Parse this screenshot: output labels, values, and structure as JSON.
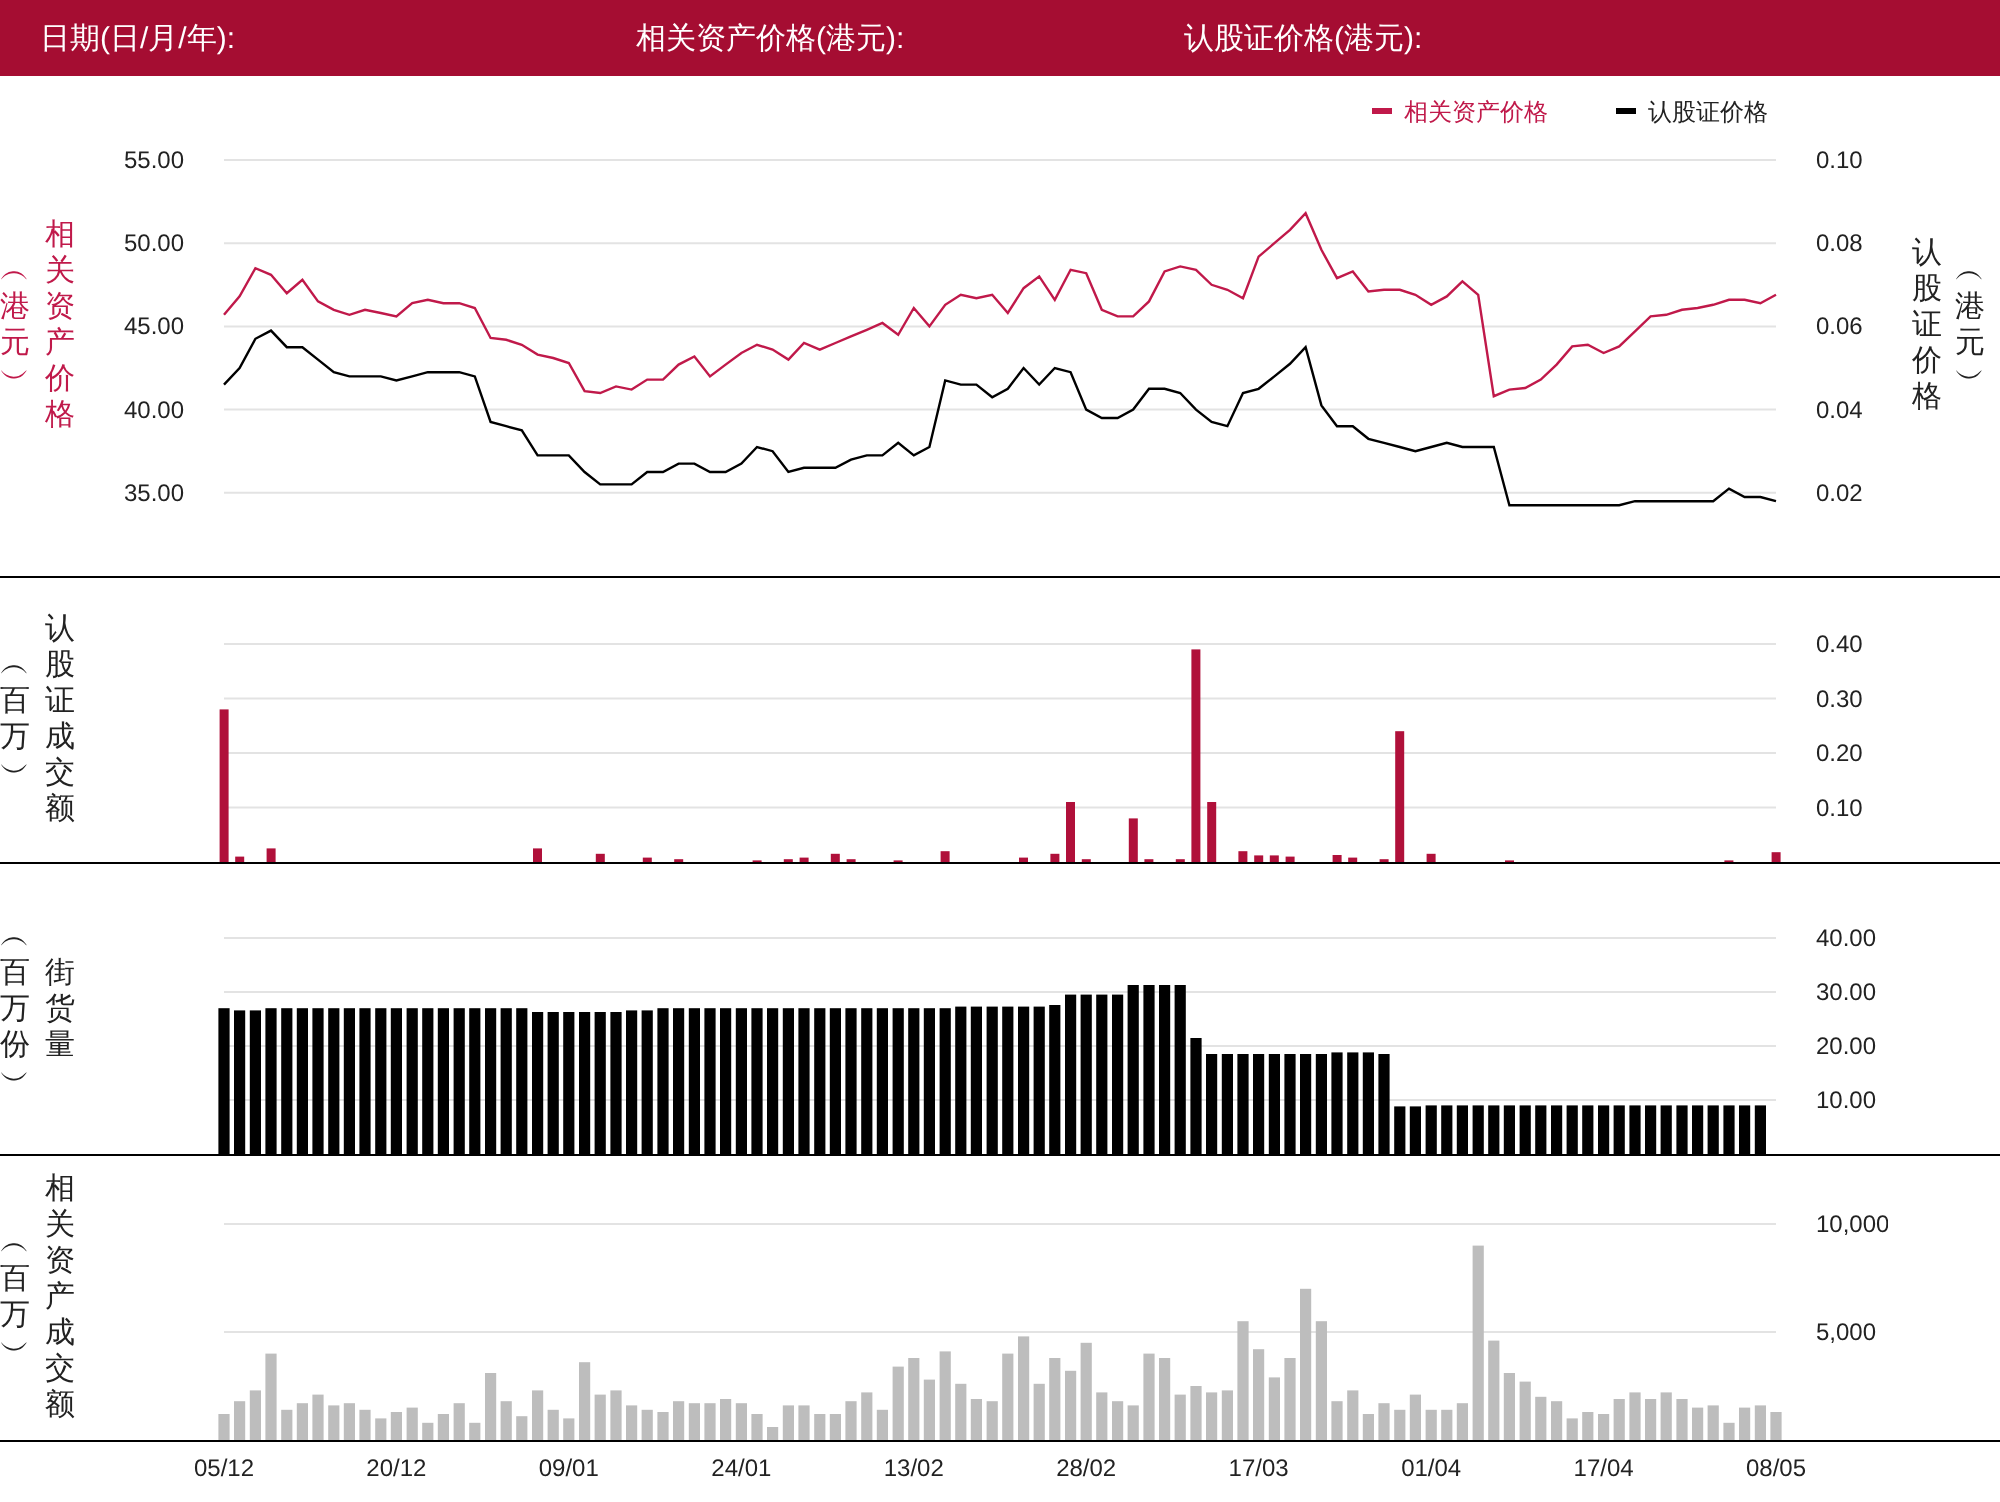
{
  "header": {
    "labels": [
      "日期(日/月/年):",
      "相关资产价格(港元):",
      "认股证价格(港元):"
    ]
  },
  "panels": [
    {
      "left_label": "相关资产价格",
      "left_unit": "︵港元︶",
      "right_label": "认股证价格",
      "right_unit": "︵港元︶",
      "chart_data": {
        "type": "line",
        "grid": true,
        "legend": "top-right",
        "ylim": [
          30,
          55
        ],
        "y2lim": [
          0,
          0.1
        ],
        "yticks": [
          {
            "value": 35,
            "label": "35.00"
          },
          {
            "value": 40,
            "label": "40.00"
          },
          {
            "value": 45,
            "label": "45.00"
          },
          {
            "value": 50,
            "label": "50.00"
          },
          {
            "value": 55,
            "label": "55.00"
          }
        ],
        "y2ticks": [
          {
            "value": 0.02,
            "label": "0.02"
          },
          {
            "value": 0.04,
            "label": "0.04"
          },
          {
            "value": 0.06,
            "label": "0.06"
          },
          {
            "value": 0.08,
            "label": "0.08"
          },
          {
            "value": 0.1,
            "label": "0.10"
          }
        ],
        "series": [
          {
            "name": "相关资产价格",
            "color": "#c0194a",
            "values": [
              45.7,
              46.8,
              48.5,
              48.1,
              47.0,
              47.8,
              46.5,
              46.0,
              45.7,
              46.0,
              45.8,
              45.6,
              46.4,
              46.6,
              46.4,
              46.4,
              46.1,
              44.3,
              44.2,
              43.9,
              43.3,
              43.1,
              42.8,
              41.1,
              41.0,
              41.4,
              41.2,
              41.8,
              41.8,
              42.7,
              43.2,
              42.0,
              42.7,
              43.4,
              43.9,
              43.6,
              43.0,
              44.0,
              43.6,
              44.0,
              44.4,
              44.8,
              45.2,
              44.5,
              46.1,
              45.0,
              46.3,
              46.9,
              46.7,
              46.9,
              45.8,
              47.3,
              48.0,
              46.6,
              48.4,
              48.2,
              46.0,
              45.6,
              45.6,
              46.5,
              48.3,
              48.6,
              48.4,
              47.5,
              47.2,
              46.7,
              49.2,
              50.0,
              50.8,
              51.8,
              49.6,
              47.9,
              48.3,
              47.1,
              47.2,
              47.2,
              46.9,
              46.3,
              46.8,
              47.7,
              46.9,
              40.8,
              41.2,
              41.3,
              41.8,
              42.7,
              43.8,
              43.9,
              43.4,
              43.8,
              44.7,
              45.6,
              45.7,
              46.0,
              46.1,
              46.3,
              46.6,
              46.6,
              46.4,
              46.9
            ]
          },
          {
            "name": "认股证价格",
            "color": "#000000",
            "axis": "y2",
            "values": [
              0.046,
              0.05,
              0.057,
              0.059,
              0.055,
              0.055,
              0.052,
              0.049,
              0.048,
              0.048,
              0.048,
              0.047,
              0.048,
              0.049,
              0.049,
              0.049,
              0.048,
              0.037,
              0.036,
              0.035,
              0.029,
              0.029,
              0.029,
              0.025,
              0.022,
              0.022,
              0.022,
              0.025,
              0.025,
              0.027,
              0.027,
              0.025,
              0.025,
              0.027,
              0.031,
              0.03,
              0.025,
              0.026,
              0.026,
              0.026,
              0.028,
              0.029,
              0.029,
              0.032,
              0.029,
              0.031,
              0.047,
              0.046,
              0.046,
              0.043,
              0.045,
              0.05,
              0.046,
              0.05,
              0.049,
              0.04,
              0.038,
              0.038,
              0.04,
              0.045,
              0.045,
              0.044,
              0.04,
              0.037,
              0.036,
              0.044,
              0.045,
              0.048,
              0.051,
              0.055,
              0.041,
              0.036,
              0.036,
              0.033,
              0.032,
              0.031,
              0.03,
              0.031,
              0.032,
              0.031,
              0.031,
              0.031,
              0.017,
              0.017,
              0.017,
              0.017,
              0.017,
              0.017,
              0.017,
              0.017,
              0.018,
              0.018,
              0.018,
              0.018,
              0.018,
              0.018,
              0.021,
              0.019,
              0.019,
              0.018
            ]
          }
        ]
      }
    },
    {
      "left_unit": "︵百万︶",
      "chart_data": {
        "type": "bar",
        "grid": true,
        "ylim": [
          0,
          0.4
        ],
        "yticks": [
          {
            "value": 0.1,
            "label": "0.10"
          },
          {
            "value": 0.2,
            "label": "0.20"
          },
          {
            "value": 0.3,
            "label": "0.30"
          },
          {
            "value": 0.4,
            "label": "0.40"
          }
        ],
        "series": [
          {
            "name": "认股证成交额",
            "color": "#b0103a",
            "values": [
              0.28,
              0.01,
              0,
              0.025,
              0,
              0,
              0,
              0,
              0,
              0,
              0,
              0,
              0,
              0,
              0,
              0,
              0,
              0,
              0,
              0,
              0.025,
              0,
              0,
              0,
              0.015,
              0,
              0,
              0.008,
              0,
              0.005,
              0,
              0,
              0,
              0,
              0.003,
              0,
              0.005,
              0.008,
              0,
              0.015,
              0.005,
              0,
              0,
              0.003,
              0,
              0,
              0.02,
              0,
              0,
              0,
              0,
              0.008,
              0,
              0.015,
              0.11,
              0.005,
              0,
              0,
              0.08,
              0.005,
              0,
              0.005,
              0.39,
              0.11,
              0,
              0.02,
              0.012,
              0.012,
              0.01,
              0,
              0,
              0.013,
              0.008,
              0,
              0.005,
              0.24,
              0,
              0.015,
              0,
              0,
              0,
              0,
              0.003,
              0,
              0,
              0,
              0,
              0,
              0,
              0,
              0,
              0,
              0,
              0,
              0,
              0,
              0.003,
              0,
              0,
              0.018
            ]
          }
        ]
      }
    },
    {
      "left_unit": "︵百万份︶",
      "chart_data": {
        "type": "bar",
        "grid": true,
        "ylim": [
          0,
          40
        ],
        "yticks": [
          {
            "value": 10,
            "label": "10.00"
          },
          {
            "value": 20,
            "label": "20.00"
          },
          {
            "value": 30,
            "label": "30.00"
          },
          {
            "value": 40,
            "label": "40.00"
          }
        ],
        "series": [
          {
            "name": "街货量",
            "color": "#000000",
            "values": [
              27,
              26.6,
              26.6,
              27,
              27,
              27,
              27,
              27,
              27,
              27,
              27,
              27,
              27,
              27,
              27,
              27,
              27,
              27,
              27,
              27,
              26.3,
              26.3,
              26.3,
              26.3,
              26.3,
              26.3,
              26.6,
              26.6,
              27,
              27,
              27,
              27,
              27,
              27,
              27,
              27,
              27,
              27,
              27,
              27,
              27,
              27,
              27,
              27,
              27,
              27,
              27,
              27.3,
              27.3,
              27.3,
              27.3,
              27.3,
              27.3,
              27.6,
              29.5,
              29.5,
              29.5,
              29.5,
              31.3,
              31.3,
              31.3,
              31.3,
              21.5,
              18.5,
              18.5,
              18.5,
              18.5,
              18.5,
              18.5,
              18.5,
              18.5,
              18.8,
              18.8,
              18.8,
              18.5,
              8.8,
              8.8,
              9,
              9,
              9,
              9,
              9,
              9,
              9,
              9,
              9,
              9,
              9,
              9,
              9,
              9,
              9,
              9,
              9,
              9,
              9,
              9,
              9,
              9,
              null
            ]
          }
        ]
      }
    },
    {
      "left_unit": "︵百万︶",
      "chart_data": {
        "type": "bar",
        "grid": true,
        "ylim": [
          0,
          10000
        ],
        "yticks": [
          {
            "value": 5000,
            "label": "5,000"
          },
          {
            "value": 10000,
            "label": "10,000"
          }
        ],
        "categories": [
          "05/12",
          null,
          null,
          null,
          null,
          null,
          null,
          null,
          null,
          null,
          null,
          "20/12",
          null,
          null,
          null,
          null,
          null,
          null,
          null,
          null,
          null,
          null,
          "09/01",
          null,
          null,
          null,
          null,
          null,
          null,
          null,
          null,
          null,
          null,
          "24/01",
          null,
          null,
          null,
          null,
          null,
          null,
          null,
          null,
          null,
          null,
          "13/02",
          null,
          null,
          null,
          null,
          null,
          null,
          null,
          null,
          null,
          null,
          "28/02",
          null,
          null,
          null,
          null,
          null,
          null,
          null,
          null,
          null,
          null,
          "17/03",
          null,
          null,
          null,
          null,
          null,
          null,
          null,
          null,
          null,
          null,
          "01/04",
          null,
          null,
          null,
          null,
          null,
          null,
          null,
          null,
          null,
          null,
          "17/04",
          null,
          null,
          null,
          null,
          null,
          null,
          null,
          null,
          null,
          null,
          "08/05"
        ],
        "series": [
          {
            "name": "相关资产成交额",
            "color": "#bdbdbd",
            "values": [
              1200,
              1800,
              2300,
              4000,
              1400,
              1700,
              2100,
              1600,
              1700,
              1400,
              1000,
              1300,
              1500,
              800,
              1200,
              1700,
              800,
              3100,
              1800,
              1100,
              2300,
              1400,
              1000,
              3600,
              2100,
              2300,
              1600,
              1400,
              1300,
              1800,
              1700,
              1700,
              1900,
              1700,
              1200,
              600,
              1600,
              1600,
              1200,
              1200,
              1800,
              2200,
              1400,
              3400,
              3800,
              2800,
              4100,
              2600,
              1900,
              1800,
              4000,
              4800,
              2600,
              3800,
              3200,
              4500,
              2200,
              1800,
              1600,
              4000,
              3800,
              2100,
              2500,
              2200,
              2300,
              5500,
              4200,
              2900,
              3800,
              7000,
              5500,
              1800,
              2300,
              1200,
              1700,
              1400,
              2100,
              1400,
              1400,
              1700,
              9000,
              4600,
              3100,
              2700,
              2000,
              1800,
              1000,
              1300,
              1200,
              1900,
              2200,
              1900,
              2200,
              1900,
              1500,
              1600,
              800,
              1500,
              1600,
              1300
            ]
          }
        ]
      }
    }
  ]
}
